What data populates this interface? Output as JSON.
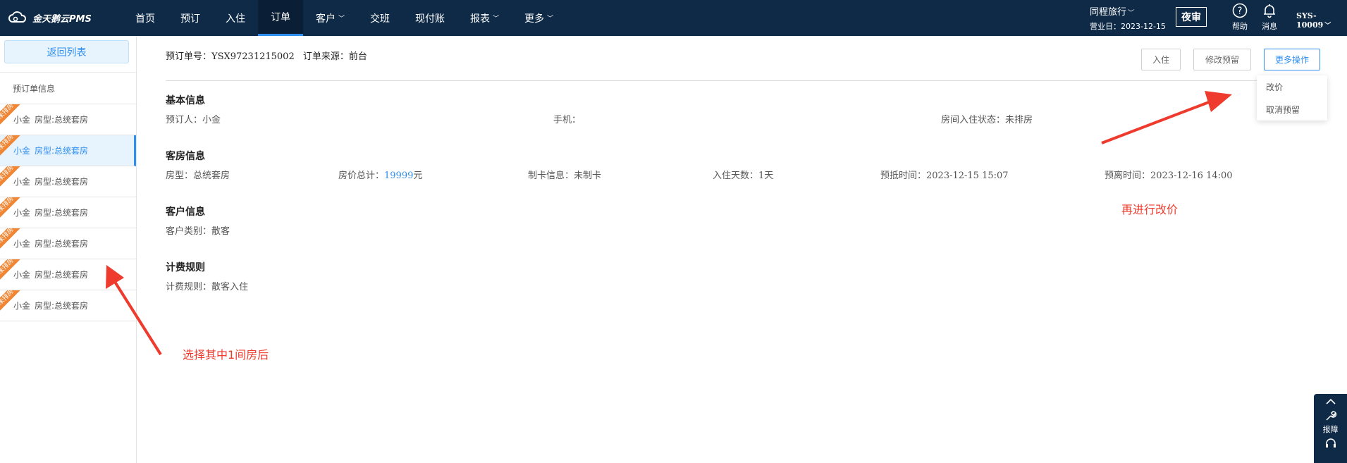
{
  "app": {
    "logo_text": "金天鹅云PMS"
  },
  "nav": [
    {
      "label": "首页",
      "dropdown": false,
      "active": false
    },
    {
      "label": "预订",
      "dropdown": false,
      "active": false
    },
    {
      "label": "入住",
      "dropdown": false,
      "active": false
    },
    {
      "label": "订单",
      "dropdown": false,
      "active": true
    },
    {
      "label": "客户",
      "dropdown": true,
      "active": false
    },
    {
      "label": "交班",
      "dropdown": false,
      "active": false
    },
    {
      "label": "现付账",
      "dropdown": false,
      "active": false
    },
    {
      "label": "报表",
      "dropdown": true,
      "active": false
    },
    {
      "label": "更多",
      "dropdown": true,
      "active": false
    }
  ],
  "header": {
    "hotel_name": "同程旅行",
    "business_date": "营业日：2023-12-15",
    "night_audit": "夜审",
    "help": "帮助",
    "messages": "消息",
    "user": "SYS-10009"
  },
  "sidebar": {
    "back_label": "返回列表",
    "section_label": "预订单信息",
    "ribbon_label": "未排房",
    "rooms": [
      {
        "guest": "小金",
        "room_type": "房型:总统套房",
        "selected": false
      },
      {
        "guest": "小金",
        "room_type": "房型:总统套房",
        "selected": true
      },
      {
        "guest": "小金",
        "room_type": "房型:总统套房",
        "selected": false
      },
      {
        "guest": "小金",
        "room_type": "房型:总统套房",
        "selected": false
      },
      {
        "guest": "小金",
        "room_type": "房型:总统套房",
        "selected": false
      },
      {
        "guest": "小金",
        "room_type": "房型:总统套房",
        "selected": false
      },
      {
        "guest": "小金",
        "room_type": "房型:总统套房",
        "selected": false
      }
    ]
  },
  "order": {
    "number_label": "预订单号：YSX97231215002",
    "source_label": "订单来源：前台",
    "actions": {
      "checkin": "入住",
      "modify": "修改预留",
      "more": "更多操作"
    },
    "more_menu": [
      "改价",
      "取消预留"
    ]
  },
  "basic": {
    "title": "基本信息",
    "booker": "预订人：小金",
    "phone": "手机：",
    "status": "房间入住状态：未排房"
  },
  "room": {
    "title": "客房信息",
    "type": "房型：总统套房",
    "price_label": "房价总计：",
    "price_value": "19999",
    "price_unit": "元",
    "card": "制卡信息：未制卡",
    "nights": "入住天数：1天",
    "arrival": "预抵时间：2023-12-15 15:07",
    "departure": "预离时间：2023-12-16 14:00"
  },
  "customer": {
    "title": "客户信息",
    "category": "客户类别：散客"
  },
  "billing": {
    "title": "计费规则",
    "rule": "计费规则：散客入住"
  },
  "annotations": {
    "select_room": "选择其中1间房后",
    "then_adjust": "再进行改价"
  },
  "float_bar": {
    "report": "报障"
  },
  "colors": {
    "topbar": "#0e2a47",
    "accent": "#2f8ff0",
    "ribbon": "#f08533",
    "annotation": "#ee3b2e"
  }
}
